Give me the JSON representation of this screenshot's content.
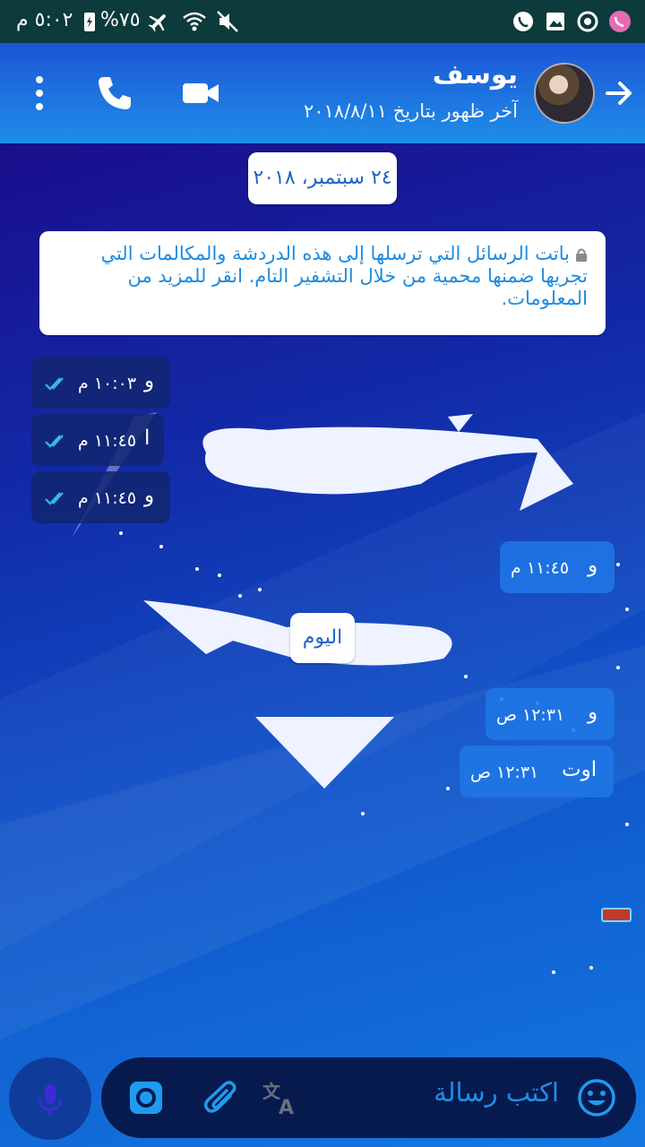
{
  "status_bar": {
    "time": "٥:٠٢ م",
    "battery_percent": "%٧٥",
    "icons": [
      "battery-charging-icon",
      "airplane-icon",
      "wifi-icon",
      "mute-icon",
      "whatsapp-icon",
      "gallery-icon",
      "sync-icon",
      "viber-icon"
    ]
  },
  "header": {
    "contact_name": "يوسف",
    "last_seen": "آخر ظهور بتاريخ ٢٠١٨/٨/١١",
    "icons": [
      "back-arrow-icon",
      "avatar",
      "video-call-icon",
      "phone-icon",
      "more-icon"
    ]
  },
  "chat": {
    "date_chip": "٢٤ سبتمبر، ٢٠١٨",
    "encryption_notice": "باتت الرسائل التي ترسلها إلى هذه الدردشة والمكالمات التي تجريها ضمنها محمية من خلال التشفير التام. انقر للمزيد من المعلومات.",
    "today_chip": "اليوم",
    "messages": [
      {
        "direction": "outgoing",
        "text": "و",
        "time": "١٠:٠٣ م",
        "status": "read"
      },
      {
        "direction": "outgoing",
        "text": "ا",
        "time": "١١:٤٥ م",
        "status": "read"
      },
      {
        "direction": "outgoing",
        "text": "و",
        "time": "١١:٤٥ م",
        "status": "read"
      },
      {
        "direction": "incoming",
        "text": "و",
        "time": "١١:٤٥ م"
      },
      {
        "direction": "incoming",
        "text": "و",
        "time": "١٢:٣١ ص"
      },
      {
        "direction": "incoming",
        "text": "اوت",
        "time": "١٢:٣١ ص"
      }
    ]
  },
  "composer": {
    "placeholder": "اكتب رسالة",
    "icons": [
      "emoji-icon",
      "translate-icon",
      "attach-icon",
      "camera-icon",
      "mic-icon"
    ]
  },
  "colors": {
    "header_accent": "#1f8ee8",
    "status_bar": "#0d3a3a",
    "read_ticks": "#34b7f1",
    "outgoing_bubble": "#12266e",
    "incoming_bubble": "#1e78e6"
  }
}
